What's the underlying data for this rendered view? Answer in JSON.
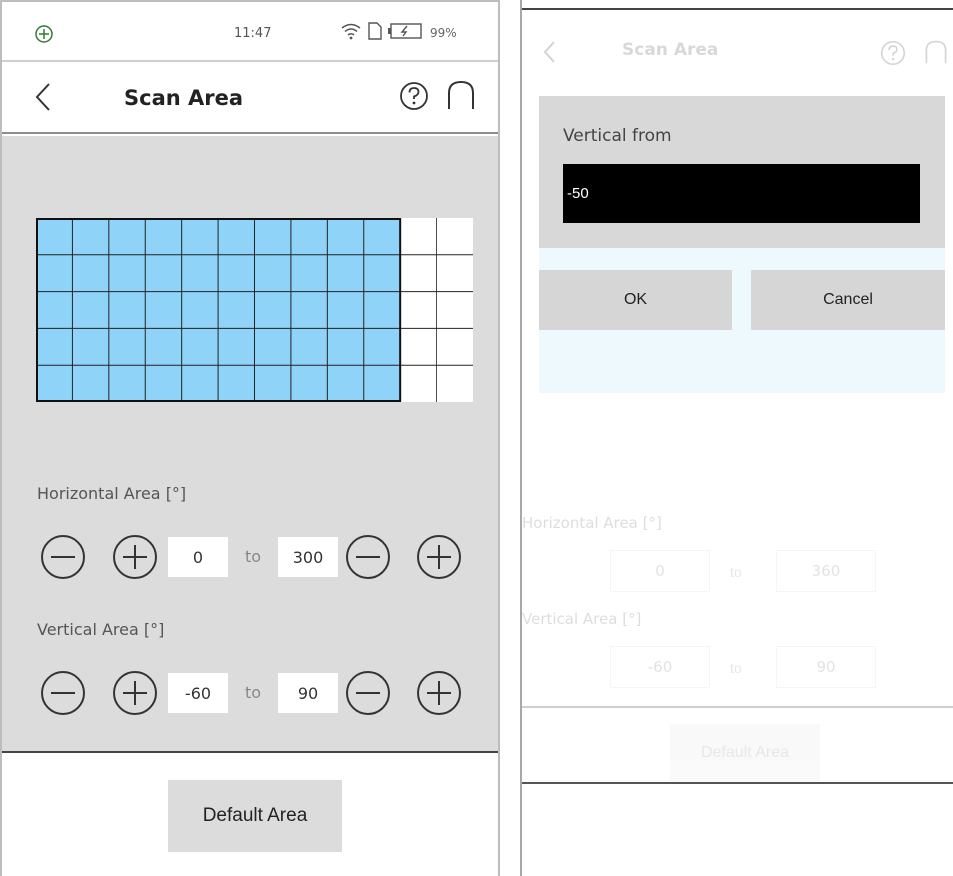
{
  "left_screen": {
    "status": {
      "time": "11:47",
      "battery": "99%"
    },
    "header": {
      "title": "Scan Area"
    },
    "horizontal": {
      "label": "Horizontal Area [°]",
      "from": "0",
      "to_word": "to",
      "to": "300"
    },
    "vertical": {
      "label": "Vertical Area [°]",
      "from": "-60",
      "to_word": "to",
      "to": "90"
    },
    "default_button": "Default Area",
    "scan_grid": {
      "columns": 12,
      "rows": 5,
      "selected_columns": 10,
      "selected_color": "#8fd3f8"
    }
  },
  "right_screen": {
    "header": {
      "title": "Scan Area"
    },
    "dialog": {
      "label": "Vertical from",
      "value": "-50",
      "ok": "OK",
      "cancel": "Cancel"
    },
    "background": {
      "horizontal_label": "Horizontal Area [°]",
      "horizontal_from": "0",
      "horizontal_to": "360",
      "vertical_label": "Vertical Area [°]",
      "vertical_from": "-60",
      "vertical_to": "90",
      "to_word": "to",
      "default_button": "Default Area"
    }
  },
  "icons": {
    "status_left": "compass-icon",
    "wifi": "wifi-icon",
    "sim": "sim-icon",
    "battery": "battery-icon",
    "back": "back-chevron-icon",
    "help": "help-icon",
    "home": "home-icon",
    "minus": "minus-circle-icon",
    "plus": "plus-circle-icon"
  }
}
